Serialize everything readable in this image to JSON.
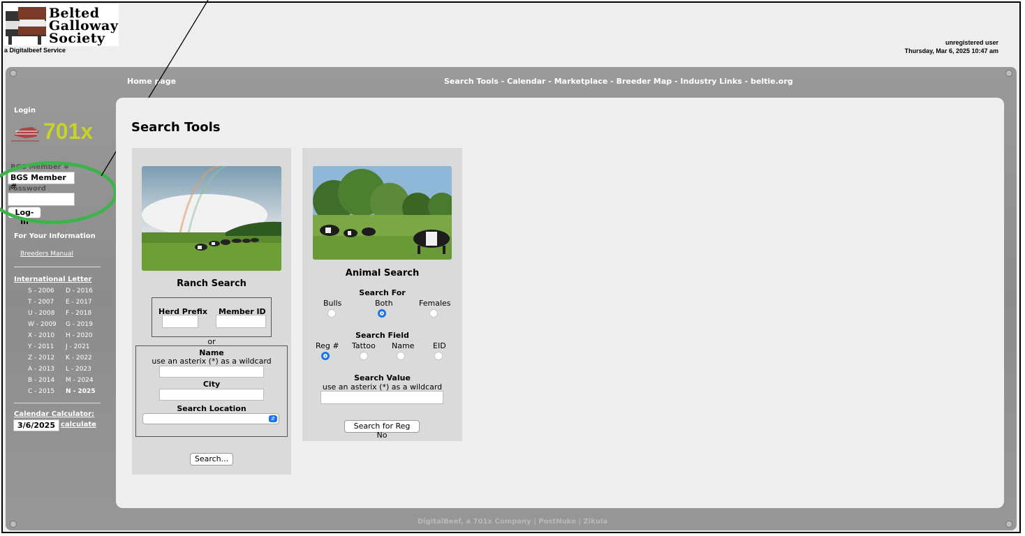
{
  "header": {
    "logo_words": [
      "Belted",
      "Galloway",
      "Society"
    ],
    "service": "a Digitalbeef Service",
    "user": "unregistered user",
    "datetime": "Thursday, Mar 6, 2025 10:47 am"
  },
  "nav": {
    "home": "Home page",
    "links": [
      "Search Tools",
      "Calendar",
      "Marketplace",
      "Breeder Map",
      "Industry Links",
      "beltie.org"
    ],
    "separator": "-"
  },
  "sidebar": {
    "login_heading": "Login",
    "logo_text": "701x",
    "member_label": "BGS Member #",
    "member_value": "BGS Member #",
    "password_label": "Password",
    "login_button": "Log-in",
    "info_heading": "For Your Information",
    "manual_link": "Breeders Manual",
    "intl_heading": "International Letter",
    "letters": [
      [
        "S - 2006",
        "D - 2016"
      ],
      [
        "T - 2007",
        "E - 2017"
      ],
      [
        "U - 2008",
        "F - 2018"
      ],
      [
        "W - 2009",
        "G - 2019"
      ],
      [
        "X - 2010",
        "H - 2020"
      ],
      [
        "Y - 2011",
        "J - 2021"
      ],
      [
        "Z - 2012",
        "K - 2022"
      ],
      [
        "A - 2013",
        "L - 2023"
      ],
      [
        "B - 2014",
        "M - 2024"
      ],
      [
        "C - 2015",
        "N - 2025"
      ]
    ],
    "calc_heading": "Calendar Calculator:",
    "calc_value": "3/6/2025",
    "calc_link": "calculate"
  },
  "main": {
    "title": "Search Tools",
    "ranch": {
      "heading": "Ranch Search",
      "herd_prefix": "Herd Prefix",
      "member_id": "Member ID",
      "or": "or",
      "name_label": "Name",
      "wildcard": "use an asterix (*) as a wildcard",
      "city_label": "City",
      "location_label": "Search Location",
      "button": "Search..."
    },
    "animal": {
      "heading": "Animal Search",
      "search_for": "Search For",
      "for_options": [
        "Bulls",
        "Both",
        "Females"
      ],
      "search_field": "Search Field",
      "field_options": [
        "Reg #",
        "Tattoo",
        "Name",
        "EID"
      ],
      "search_value": "Search Value",
      "wildcard": "use an asterix (*) as a wildcard",
      "button": "Search for Reg No"
    }
  },
  "footer": {
    "items": [
      "DigitalBeef, a 701x Company",
      "PostNuke",
      "Zikula"
    ],
    "separator": "|"
  }
}
